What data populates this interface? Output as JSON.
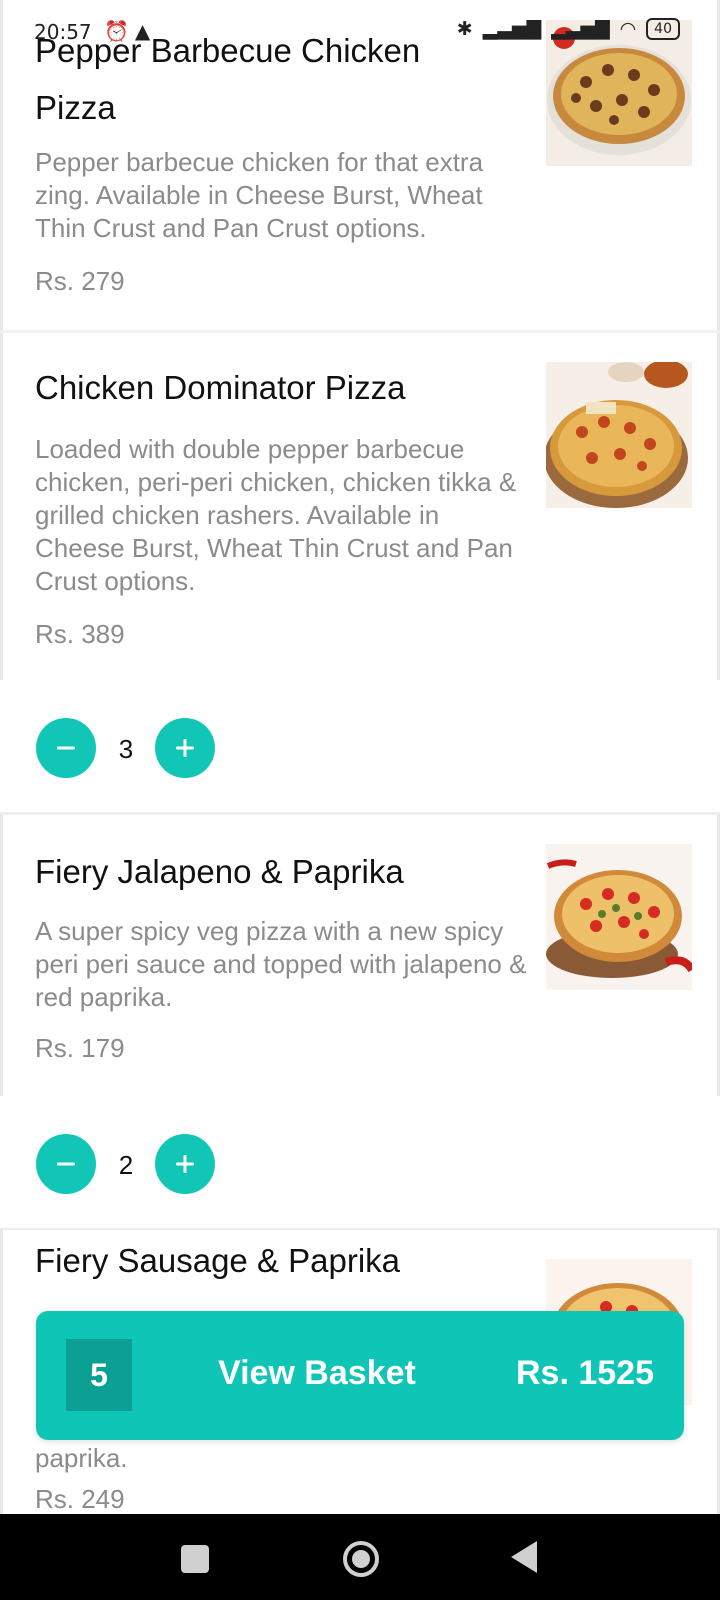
{
  "status_bar": {
    "time": "20:57",
    "left_icons": [
      "alarm-icon",
      "notification-icon"
    ],
    "right_icons": [
      "bluetooth-icon",
      "signal-icon",
      "signal-icon",
      "wifi-icon"
    ],
    "battery": "40"
  },
  "items": [
    {
      "title_line1": "Pepper Barbecue Chicken",
      "title_line2": "Pizza",
      "description": "Pepper barbecue chicken for that extra zing. Available in Cheese Burst, Wheat Thin Crust and Pan Crust options.",
      "price": "Rs. 279"
    },
    {
      "title": "Chicken Dominator Pizza",
      "description": "Loaded with double pepper barbecue chicken, peri-peri chicken, chicken tikka & grilled chicken rashers. Available in Cheese Burst, Wheat Thin Crust and Pan Crust options.",
      "price": "Rs. 389",
      "quantity": "3"
    },
    {
      "title": "Fiery Jalapeno & Paprika",
      "description": "A super spicy veg pizza with a new spicy peri peri sauce and topped with jalapeno & red paprika.",
      "price": "Rs. 179",
      "quantity": "2"
    },
    {
      "title": "Fiery Sausage & Paprika",
      "description_visible_tail": "paprika.",
      "price": "Rs. 249"
    }
  ],
  "basket": {
    "count": "5",
    "label": "View Basket",
    "total": "Rs. 1525"
  },
  "colors": {
    "accent": "#11c6b6",
    "accent_dark": "#0c9f93",
    "muted_text": "#8b8b8b"
  }
}
